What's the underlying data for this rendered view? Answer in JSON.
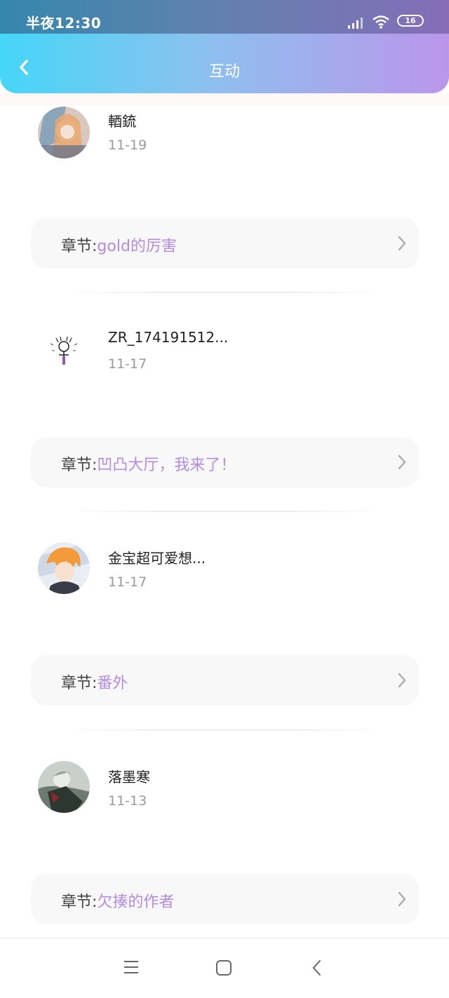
{
  "status": {
    "time": "半夜12:30",
    "battery": "16"
  },
  "header": {
    "title": "互动"
  },
  "chapter_prefix": "章节:",
  "items": [
    {
      "name": "輏鋶",
      "date": "11-19",
      "chapter": "gold的厉害"
    },
    {
      "name": "ZR_174191512...",
      "date": "11-17",
      "chapter": "凹凸大厅，我来了！"
    },
    {
      "name": "金宝超可爱想...",
      "date": "11-17",
      "chapter": "番外"
    },
    {
      "name": "落墨寒",
      "date": "11-13",
      "chapter": "欠揍的作者"
    }
  ],
  "colors": {
    "accent": "#b48de0",
    "header_start": "#45d6f7",
    "header_end": "#bb96eb"
  }
}
